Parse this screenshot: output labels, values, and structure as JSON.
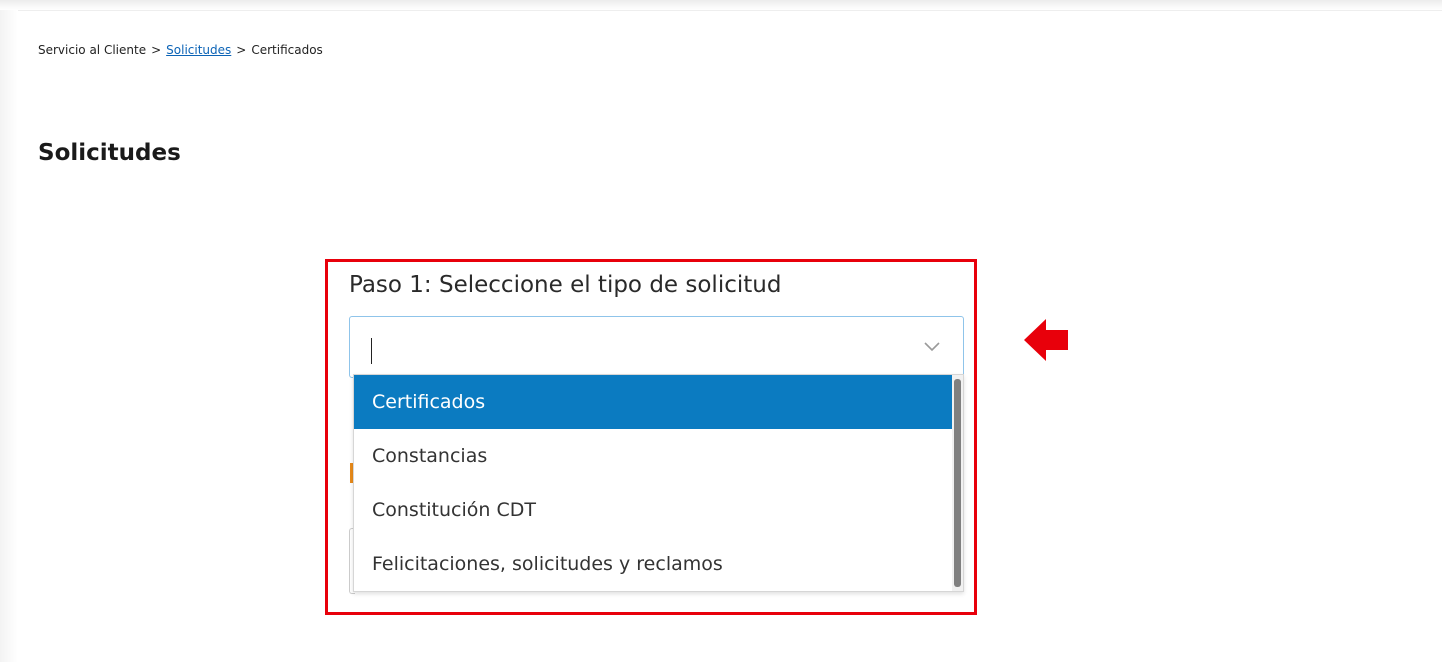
{
  "breadcrumb": {
    "home": "Servicio al Cliente",
    "separator": ">",
    "section": "Solicitudes",
    "current": "Certificados"
  },
  "page": {
    "title": "Solicitudes"
  },
  "form": {
    "step_label": "Paso 1: Seleccione el tipo de solicitud",
    "select_value": "",
    "options": [
      "Certificados",
      "Constancias",
      "Constitución CDT",
      "Felicitaciones, solicitudes y reclamos"
    ],
    "selected_option": "Certificados"
  },
  "colors": {
    "highlight_border": "#e8000b",
    "arrow": "#e8000b",
    "selected_option_bg": "#0b7bc1",
    "link": "#0b63b6",
    "select_border": "#8fc4ea"
  },
  "icons": {
    "select_toggle": "chevron-down-icon",
    "annotation": "arrow-left-icon"
  }
}
